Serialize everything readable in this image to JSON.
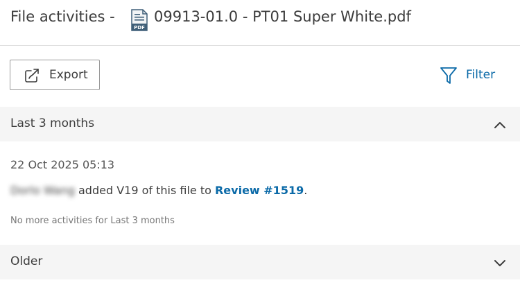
{
  "header": {
    "title_prefix": "File activities -",
    "file_icon": "pdf-file-icon",
    "file_icon_label": "PDF",
    "file_name": "09913-01.0 - PT01 Super White.pdf"
  },
  "toolbar": {
    "export_label": "Export",
    "export_icon": "share-export-icon",
    "filter_label": "Filter",
    "filter_icon": "filter-funnel-icon"
  },
  "sections": [
    {
      "label": "Last 3 months",
      "expanded": true,
      "activities": [
        {
          "timestamp": "22 Oct 2025 05:13",
          "user": "Dorlo Wang",
          "action_text": " added V19 of this file to ",
          "link_text": "Review #1519",
          "suffix": "."
        }
      ],
      "no_more_text": "No more activities for Last 3 months"
    },
    {
      "label": "Older",
      "expanded": false
    }
  ],
  "colors": {
    "link": "#0b6aa8",
    "section_bg": "#f5f5f5",
    "text": "#3c3c3c"
  }
}
